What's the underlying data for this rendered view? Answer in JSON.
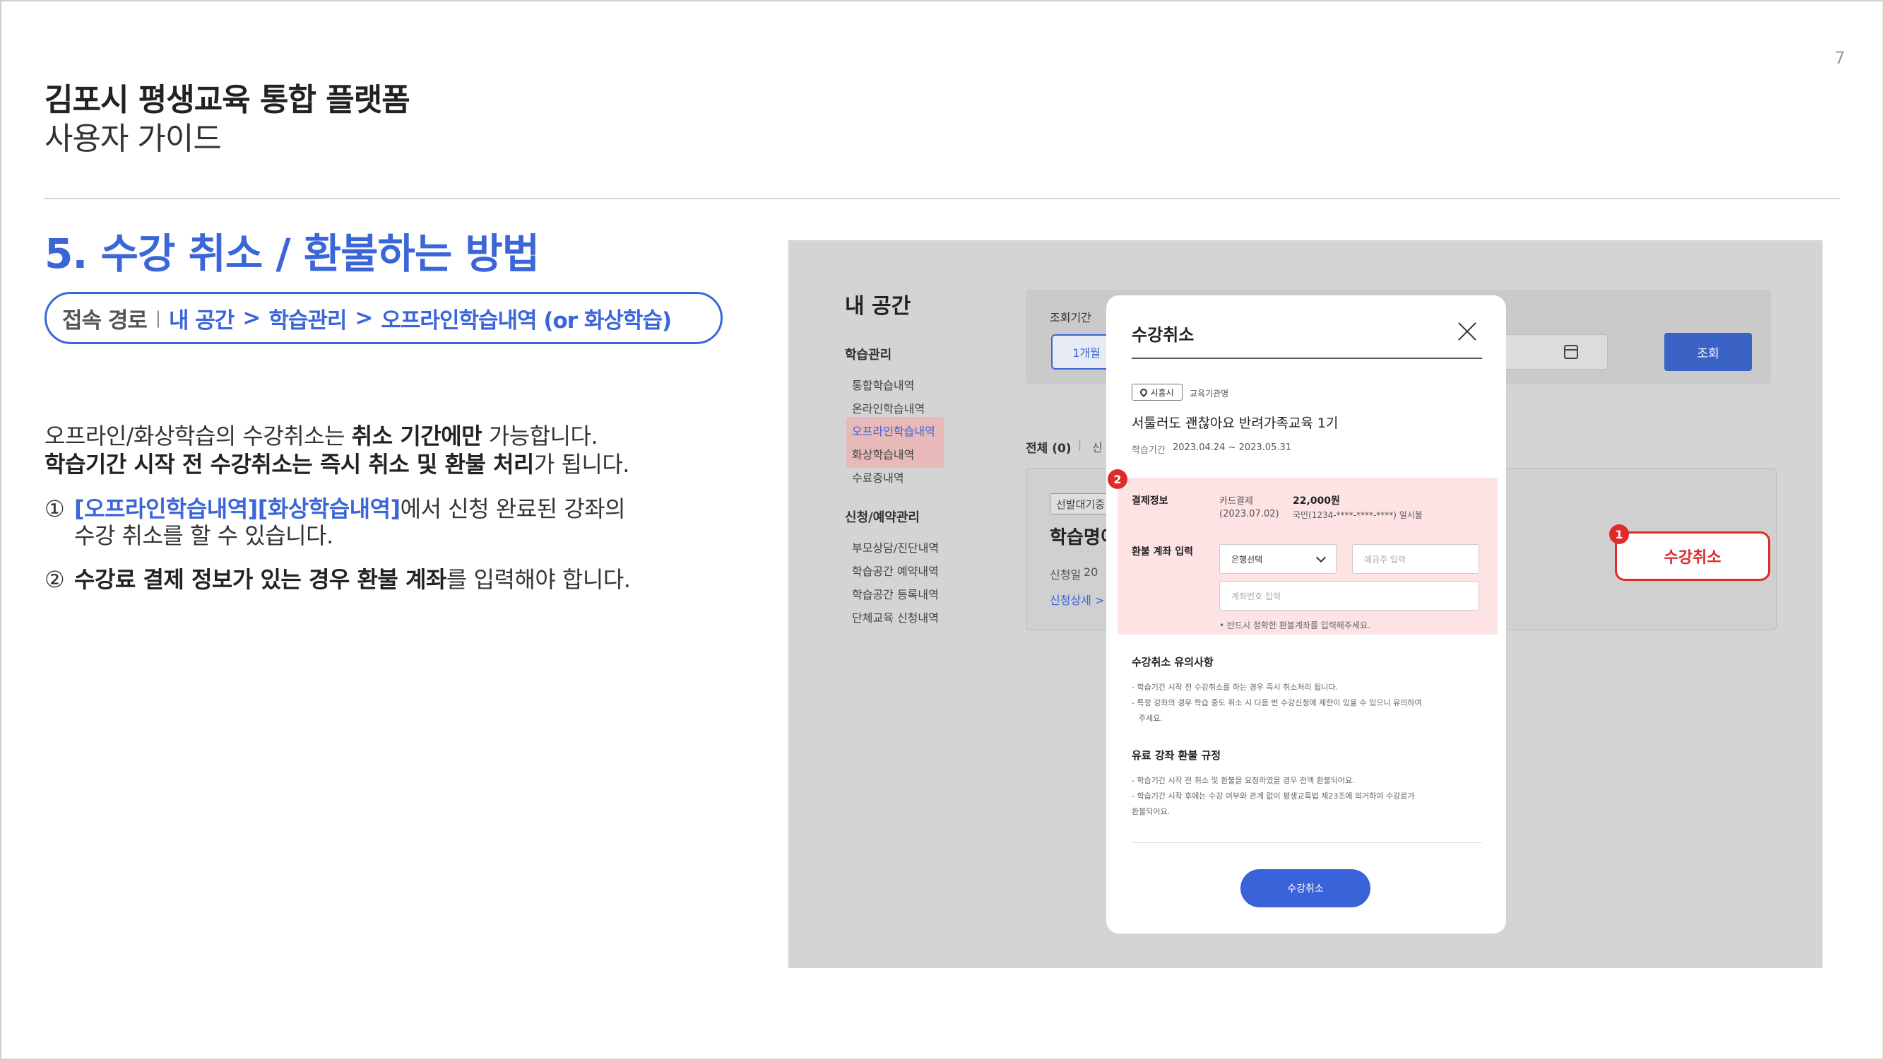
{
  "page_number": "7",
  "doc": {
    "title": "김포시 평생교육 통합 플랫폼",
    "subtitle": "사용자 가이드"
  },
  "section": {
    "title": "5. 수강 취소 / 환불하는 방법",
    "path_label": "접속 경로",
    "path_sep": "|",
    "path_items": [
      "내 공간",
      "학습관리",
      "오프라인학습내역 (or 화상학습)"
    ],
    "path_gt": ">"
  },
  "description": {
    "line1_a": "오프라인/화상학습의 수강취소는 ",
    "line1_b": "취소 기간에만",
    "line1_c": " 가능합니다.",
    "line2_a": "학습기간 시작 전 수강취소는 즉시 취소 및 환불 처리",
    "line2_b": "가 됩니다.",
    "step1_num": "①",
    "step1_a": "[오프라인학습내역][화상학습내역]",
    "step1_b": "에서 신청 완료된 강좌의",
    "step1_c": "수강 취소를 할 수 있습니다.",
    "step2_num": "②",
    "step2_a": "수강료 결제 정보가 있는 경우 환불 계좌",
    "step2_b": "를 입력해야 합니다."
  },
  "screenshot": {
    "sidebar": {
      "title": "내 공간",
      "group1": "학습관리",
      "group1_items": [
        "통합학습내역",
        "온라인학습내역",
        "오프라인학습내역",
        "화상학습내역",
        "수료증내역"
      ],
      "group2": "신청/예약관리",
      "group2_items": [
        "부모상담/진단내역",
        "학습공간 예약내역",
        "학습공간 등록내역",
        "단체교육 신청내역"
      ]
    },
    "filter": {
      "label": "조회기간",
      "period_button": "1개월",
      "search_button": "조회"
    },
    "list": {
      "tab_all": "전체 (0)",
      "tab_sep": "|",
      "tab_next": "신",
      "tag": "선발대기중",
      "title": "학습명이",
      "date_label": "신청일",
      "date_value": "20",
      "detail_link": "신청상세 >",
      "cancel_button": "수강취소",
      "badge1": "1"
    },
    "modal": {
      "title": "수강취소",
      "location_tag": "시흥시",
      "org": "교육기관명",
      "course": "서툴러도 괜찮아요 반려가족교육 1기",
      "period_label": "학습기간",
      "period_value": "2023.04.24 ~ 2023.05.31",
      "badge2": "2",
      "payment_label": "결제정보",
      "payment_method": "카드결제",
      "payment_date": "(2023.07.02)",
      "payment_amount": "22,000원",
      "payment_card": "국민(1234-****-****-****) 일시불",
      "refund_label": "환불 계좌 입력",
      "bank_select": "은행선택",
      "holder_placeholder": "예금주 입력",
      "account_placeholder": "계좌번호 입력",
      "refund_note": "• 반드시 정확한 환불계좌를 입력해주세요.",
      "notice_title": "수강취소 유의사항",
      "notice_1": "- 학습기간 시작 전 수강취소를 하는 경우 즉시 취소처리 됩니다.",
      "notice_2": "- 특정 강좌의 경우 학습 중도 취소 시 다음 번 수강신청에 제한이 있을 수 있으니 유의하여",
      "notice_2b": "주세요.",
      "refund_title": "유료 강좌 환불 규정",
      "refund_1": "- 학습기간 시작 전 취소 및 환불을 요청하였을 경우 전액 환불되어요.",
      "refund_2": "- 학습기간 시작 후에는 수강 여부와 관계 없이 평생교육법 제23조에 의거하여 수강료가",
      "refund_2b": "환불되어요.",
      "submit": "수강취소"
    }
  },
  "colors": {
    "accent": "#3b66d8",
    "highlight_red": "#e02b2b",
    "highlight_pink": "#fde3e3"
  }
}
